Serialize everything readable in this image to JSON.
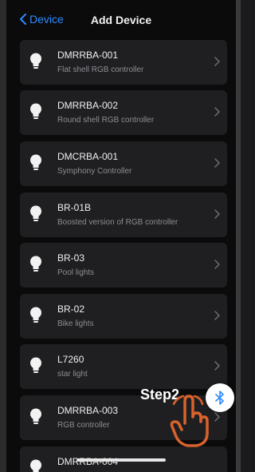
{
  "nav": {
    "back_label": "Device",
    "title": "Add Device"
  },
  "devices": [
    {
      "name": "DMRRBA-001",
      "description": "Flat shell RGB controller"
    },
    {
      "name": "DMRRBA-002",
      "description": "Round shell RGB controller"
    },
    {
      "name": "DMCRBA-001",
      "description": "Symphony Controller"
    },
    {
      "name": "BR-01B",
      "description": "Boosted version of RGB controller"
    },
    {
      "name": "BR-03",
      "description": "Pool lights"
    },
    {
      "name": "BR-02",
      "description": "Bike lights"
    },
    {
      "name": "L7260",
      "description": "star light"
    },
    {
      "name": "DMRRBA-003",
      "description": "RGB controller"
    },
    {
      "name": "DMRRBA-004",
      "description": ""
    }
  ],
  "overlay": {
    "step_label": "Step2"
  },
  "colors": {
    "accent": "#2d8cff",
    "row_bg": "#1f1f22",
    "hand": "#d9622b"
  },
  "icons": [
    "chevron-left-icon",
    "bulb-icon",
    "chevron-right-icon",
    "bluetooth-icon",
    "pointing-hand-icon"
  ]
}
